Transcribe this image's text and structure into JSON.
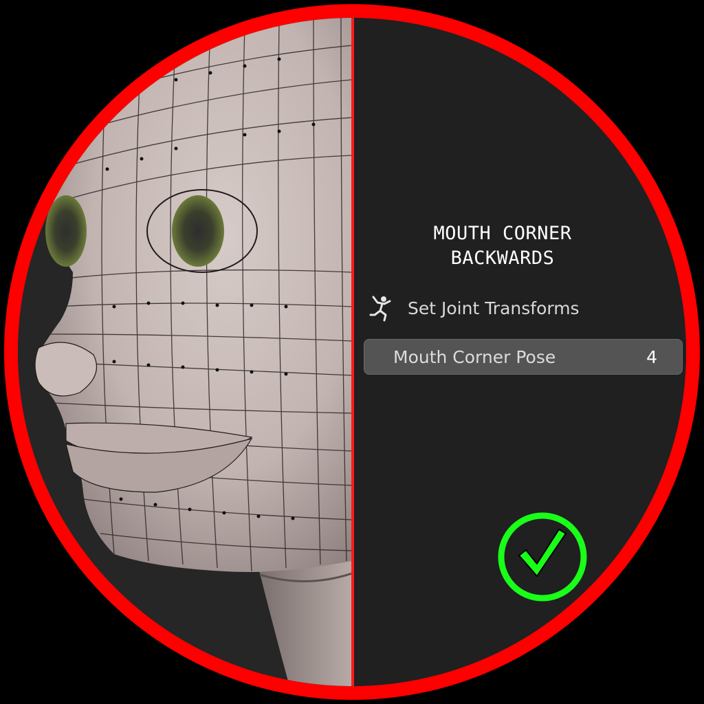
{
  "pose": {
    "title_line1": "MOUTH CORNER",
    "title_line2": "BACKWARDS"
  },
  "operator": {
    "label": "Set Joint Transforms",
    "icon": "pose-figure-icon"
  },
  "field": {
    "label": "Mouth Corner Pose",
    "value": "4"
  },
  "status": {
    "icon": "checkmark-circle-icon",
    "color": "#1aff1a"
  },
  "colors": {
    "ring": "#ff0000",
    "panel": "#202020",
    "field": "#545454"
  }
}
